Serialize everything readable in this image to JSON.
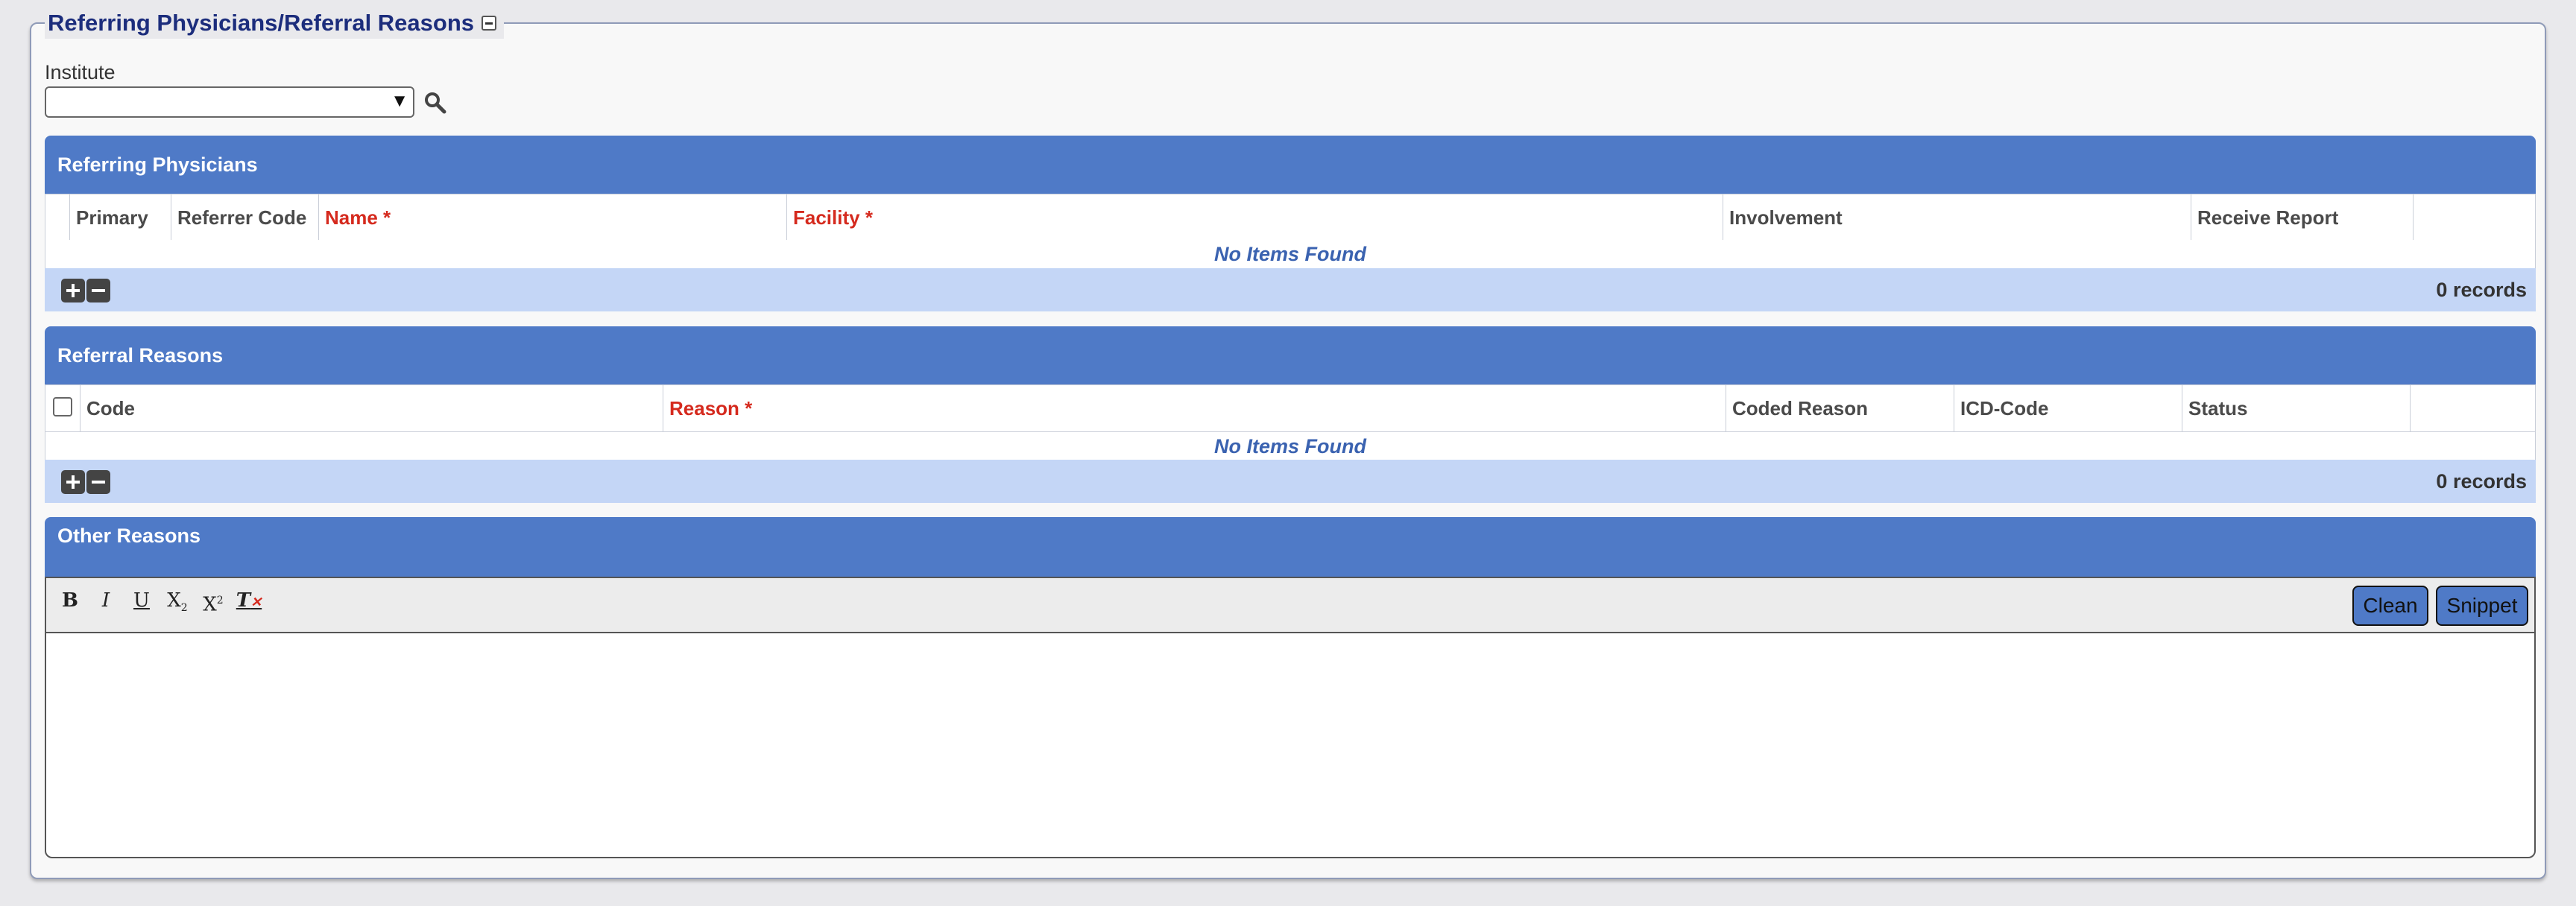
{
  "section": {
    "title": "Referring Physicians/Referral Reasons"
  },
  "institute": {
    "label": "Institute",
    "value": ""
  },
  "physicians": {
    "title": "Referring Physicians",
    "columns": [
      "",
      "Primary",
      "Referrer Code",
      "Name *",
      "Facility *",
      "Involvement",
      "Receive Report",
      ""
    ],
    "empty_text": "No Items Found",
    "records": "0 records"
  },
  "reasons": {
    "title": "Referral Reasons",
    "columns": [
      "",
      "Code",
      "Reason *",
      "Coded Reason",
      "ICD-Code",
      "Status",
      ""
    ],
    "empty_text": "No Items Found",
    "records": "0 records"
  },
  "other": {
    "title": "Other Reasons",
    "toolbar": {
      "bold": "B",
      "italic": "I",
      "underline": "U",
      "subscript": "X",
      "sub_mark": "2",
      "superscript": "X",
      "sup_mark": "2",
      "clear_format": "T"
    },
    "clean_label": "Clean",
    "snippet_label": "Snippet",
    "text": ""
  },
  "colors": {
    "header": "#4f7ac7",
    "footer": "#c4d6f6",
    "required": "#d52a1e",
    "title": "#1c2d7c"
  }
}
